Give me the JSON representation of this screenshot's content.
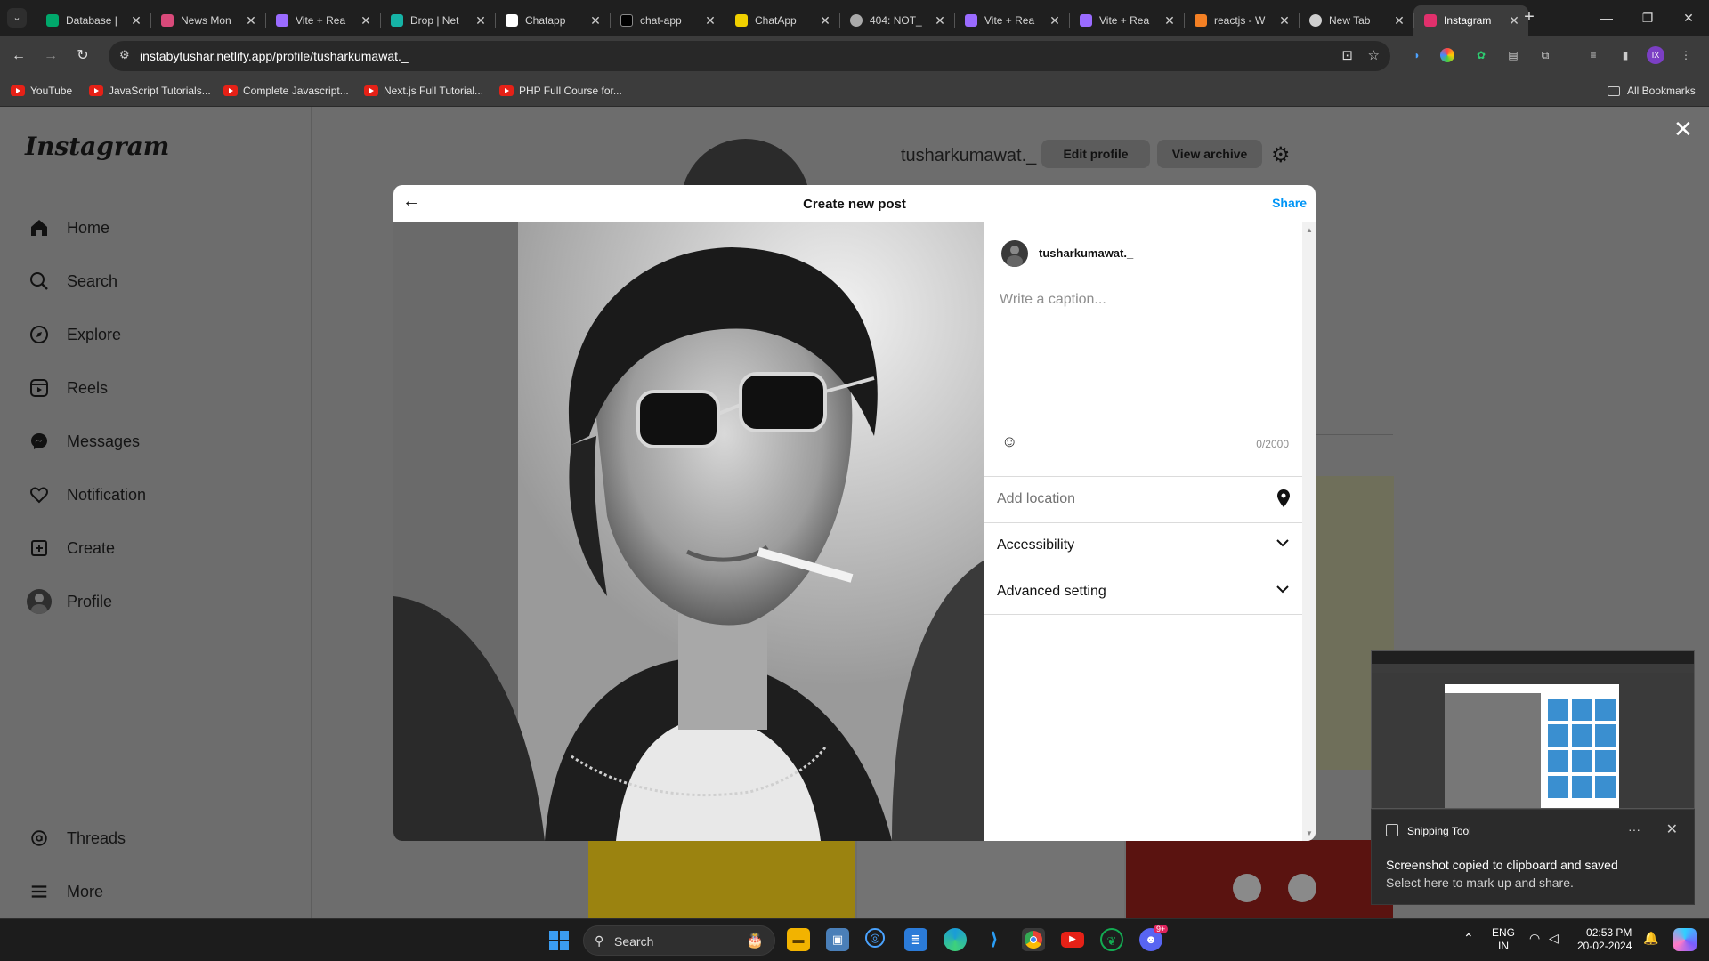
{
  "browser": {
    "tabs": [
      {
        "title": "Database |",
        "color": "#00a86b"
      },
      {
        "title": "News Mon",
        "color": "#d94a7a"
      },
      {
        "title": "Vite + Rea",
        "color": "#9a6bff"
      },
      {
        "title": "Drop | Net",
        "color": "#16b3a6"
      },
      {
        "title": "Chatapp",
        "color": "#ffffff"
      },
      {
        "title": "chat-app",
        "color": "#000000"
      },
      {
        "title": "ChatApp",
        "color": "#f0d000"
      },
      {
        "title": "404: NOT_",
        "color": "#aaaaaa"
      },
      {
        "title": "Vite + Rea",
        "color": "#9a6bff"
      },
      {
        "title": "Vite + Rea",
        "color": "#9a6bff"
      },
      {
        "title": "reactjs - W",
        "color": "#f48024"
      },
      {
        "title": "New Tab",
        "color": "#cfcfcf"
      },
      {
        "title": "Instagram",
        "color": "#e1306c"
      }
    ],
    "url": "instabytushar.netlify.app/profile/tusharkumawat._",
    "bookmarks": [
      "YouTube",
      "JavaScript Tutorials...",
      "Complete Javascript...",
      "Next.js Full Tutorial...",
      "PHP Full Course for..."
    ],
    "all_bookmarks": "All Bookmarks",
    "profile_initials": "IX"
  },
  "sidebar": {
    "logo": "Instagram",
    "items": [
      {
        "label": "Home",
        "icon": "home-icon"
      },
      {
        "label": "Search",
        "icon": "search-icon"
      },
      {
        "label": "Explore",
        "icon": "compass-icon"
      },
      {
        "label": "Reels",
        "icon": "reels-icon"
      },
      {
        "label": "Messages",
        "icon": "messenger-icon"
      },
      {
        "label": "Notification",
        "icon": "heart-icon"
      },
      {
        "label": "Create",
        "icon": "plus-square-icon"
      },
      {
        "label": "Profile",
        "icon": "avatar-icon"
      }
    ],
    "bottom": [
      {
        "label": "Threads",
        "icon": "threads-icon"
      },
      {
        "label": "More",
        "icon": "menu-icon"
      }
    ]
  },
  "profile": {
    "username": "tusharkumawat._",
    "edit_label": "Edit profile",
    "archive_label": "View archive"
  },
  "modal": {
    "title": "Create new post",
    "share_label": "Share",
    "username": "tusharkumawat._",
    "caption_placeholder": "Write a caption...",
    "char_count": "0/2000",
    "rows": {
      "location": "Add location",
      "accessibility": "Accessibility",
      "advanced": "Advanced setting"
    }
  },
  "toast": {
    "app": "Snipping Tool",
    "message": "Screenshot copied to clipboard and saved",
    "sub": "Select here to mark up and share."
  },
  "taskbar": {
    "search_label": "Search",
    "lang": "ENG",
    "region": "IN",
    "time": "02:53 PM",
    "date": "20-02-2024",
    "discord_badge": "9+"
  }
}
